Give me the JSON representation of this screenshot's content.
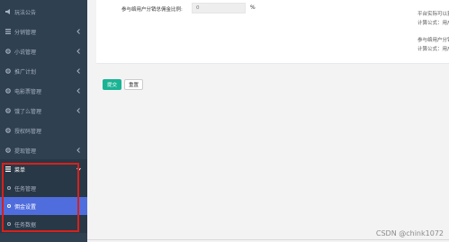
{
  "sidebar": {
    "items": [
      {
        "label": "玩法公告",
        "icon": "announcement-icon",
        "chevron": false
      },
      {
        "label": "分销管理",
        "icon": "list-icon",
        "chevron": true
      },
      {
        "label": "小说管理",
        "icon": "gear-icon",
        "chevron": true
      },
      {
        "label": "推广计划",
        "icon": "gear-icon",
        "chevron": true
      },
      {
        "label": "电影票管理",
        "icon": "gear-icon",
        "chevron": true
      },
      {
        "label": "饿了么管理",
        "icon": "gear-icon",
        "chevron": true
      },
      {
        "label": "授权码管理",
        "icon": "gear-icon",
        "chevron": false
      },
      {
        "label": "提现管理",
        "icon": "gear-icon",
        "chevron": true
      },
      {
        "label": "菜单",
        "icon": "list-icon",
        "chevron": true
      }
    ],
    "subitems": [
      {
        "label": "任务管理"
      },
      {
        "label": "佣金设置"
      },
      {
        "label": "任务数据"
      }
    ]
  },
  "form": {
    "label": "参与络用户分销总佣金比例:",
    "value": "0",
    "unit": "%"
  },
  "help": {
    "line1": "平台实际可以获得",
    "line2": "计算公式：用户充",
    "line3": "参与络用户分销总",
    "line4": "计算公式：用户充"
  },
  "buttons": {
    "submit": "提交",
    "reset": "重置"
  },
  "watermark": "CSDN @chink1072",
  "colors": {
    "sidebar": "#2f4050",
    "active": "#4f6ddd",
    "submit": "#1ab394",
    "annotation": "#d9201b"
  }
}
